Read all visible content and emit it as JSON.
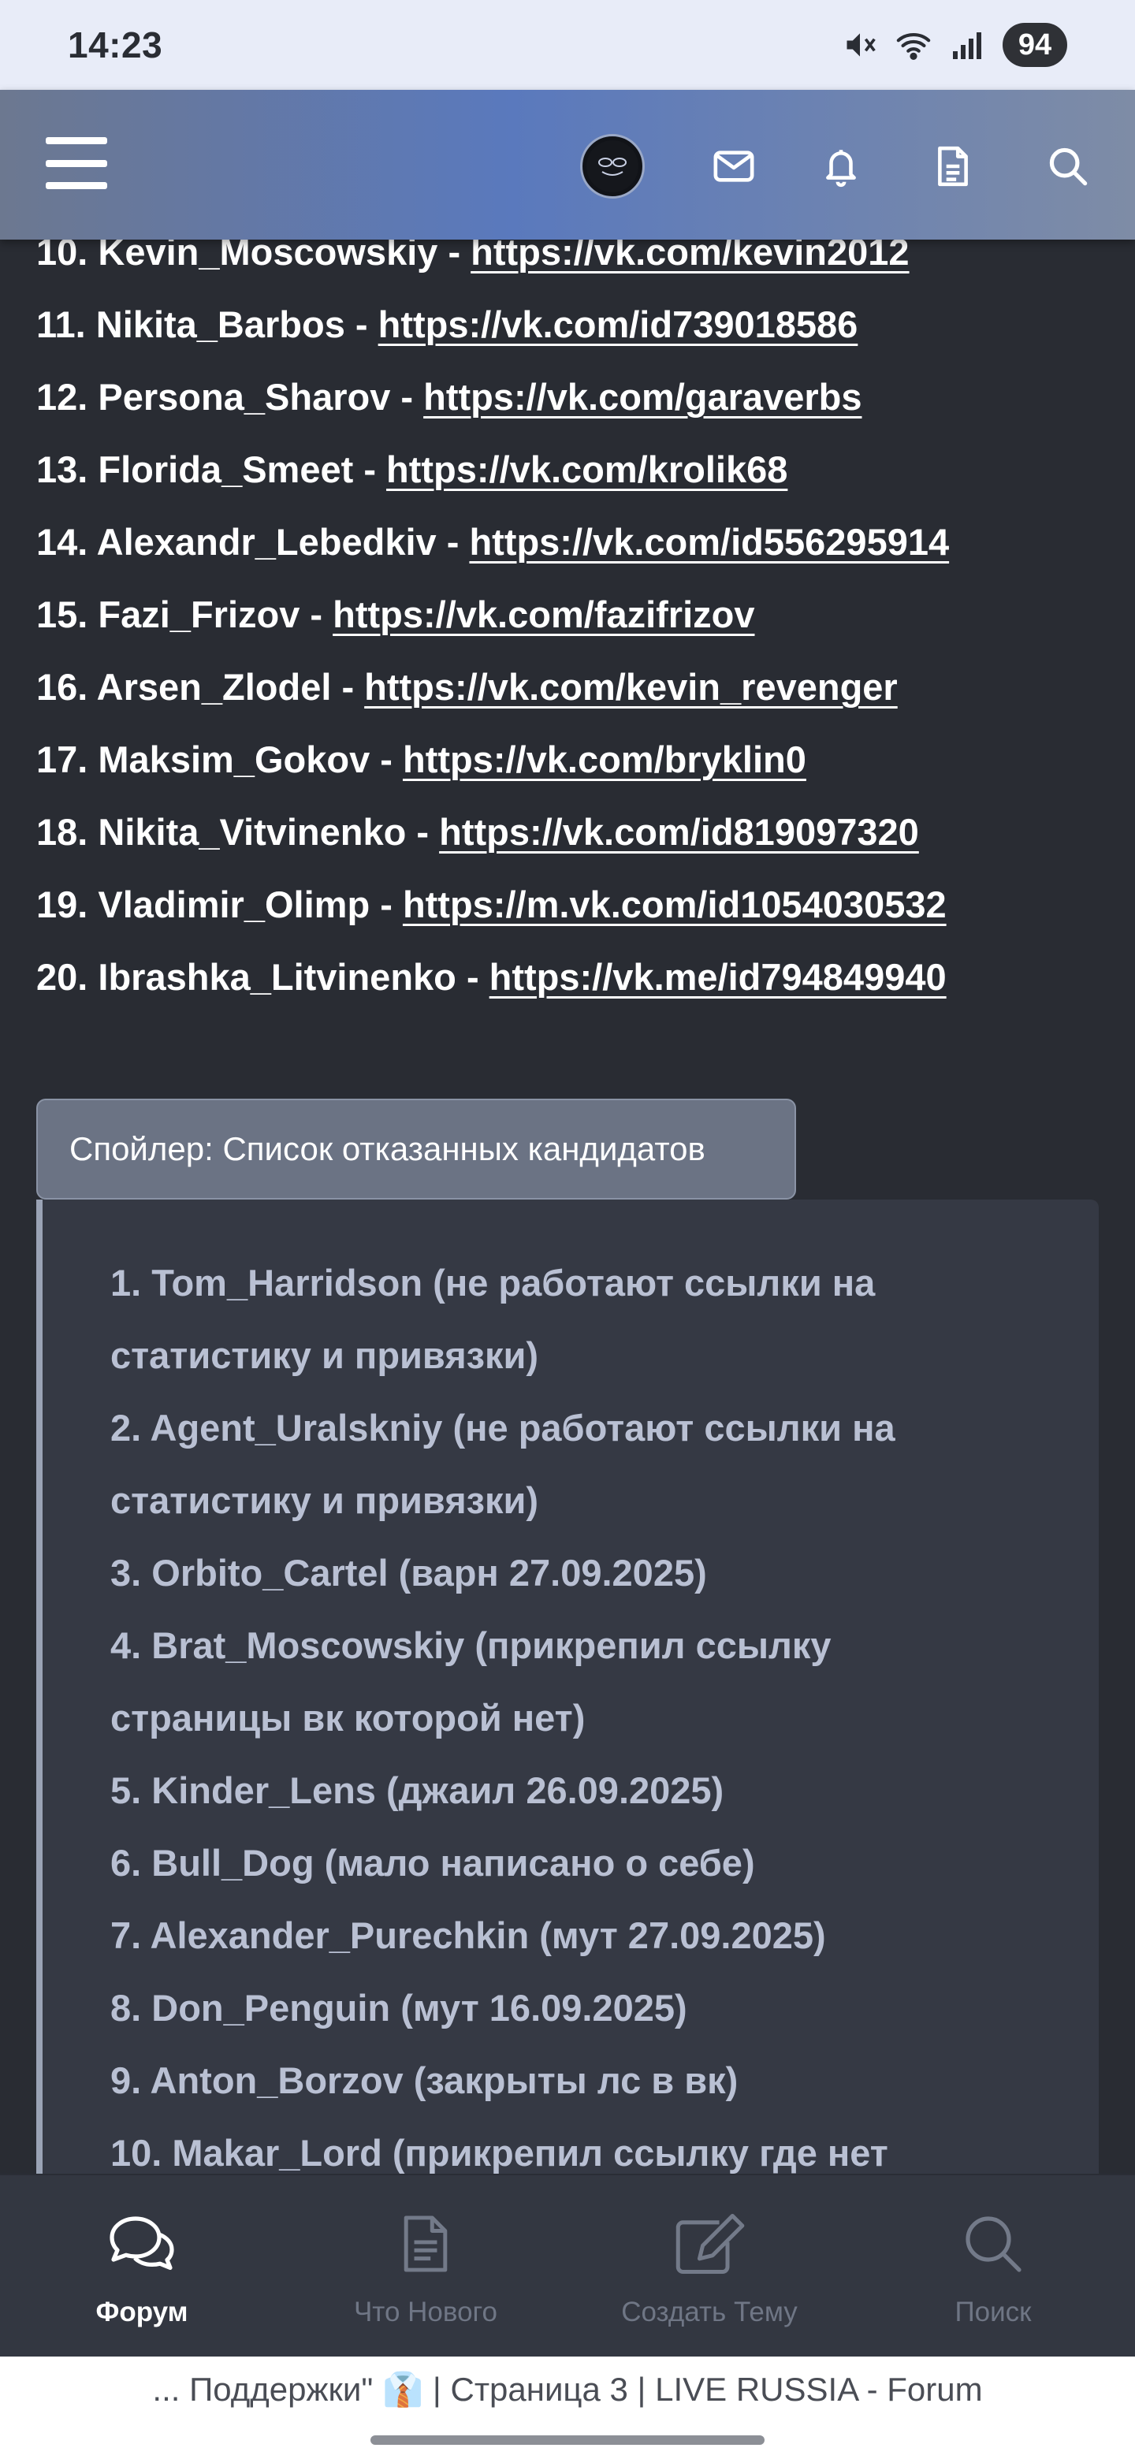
{
  "status_bar": {
    "time": "14:23",
    "battery": "94",
    "icons": [
      "mute-icon",
      "wifi-icon",
      "signal-icon"
    ]
  },
  "header": {
    "icons": [
      "menu-icon",
      "avatar",
      "mail-icon",
      "bell-icon",
      "document-icon",
      "search-icon"
    ]
  },
  "accepted_list": [
    {
      "text": "10. Kevin_Moscowskiy - ",
      "link": "https://vk.com/kevin2012"
    },
    {
      "text": "11. Nikita_Barbos - ",
      "link": "https://vk.com/id739018586"
    },
    {
      "text": "12. Persona_Sharov - ",
      "link": "https://vk.com/garaverbs"
    },
    {
      "text": "13. Florida_Smeet - ",
      "link": "https://vk.com/krolik68"
    },
    {
      "text": "14. Alexandr_Lebedkiv - ",
      "link": "https://vk.com/id556295914"
    },
    {
      "text": "15. Fazi_Frizov - ",
      "link": "https://vk.com/fazifrizov"
    },
    {
      "text": "16. Arsen_Zlodel - ",
      "link": "https://vk.com/kevin_revenger"
    },
    {
      "text": "17. Maksim_Gokov - ",
      "link": "https://vk.com/bryklin0"
    },
    {
      "text": "18. Nikita_Vitvinenko - ",
      "link": "https://vk.com/id819097320"
    },
    {
      "text": "19. Vladimir_Olimp - ",
      "link": "https://m.vk.com/id1054030532"
    },
    {
      "text": "20. Ibrashka_Litvinenko - ",
      "link": "https://vk.me/id794849940"
    }
  ],
  "spoiler": {
    "button_label": "Спойлер: Список отказанных кандидатов",
    "lines": [
      "1. Tom_Harridson (не работают ссылки на",
      "статистику и привязки)",
      "2. Agent_Uralskniy (не работают ссылки на",
      "статистику и привязки)",
      "3. Orbito_Cartel (варн 27.09.2025)",
      "4. Brat_Moscowskiy (прикрепил ссылку",
      "страницы вк которой нет)",
      "5. Kinder_Lens (джаил 26.09.2025)",
      "6. Bull_Dog (мало написано о себе)",
      "7. Alexander_Purechkin (мут 27.09.2025)",
      "8. Don_Penguin (мут 16.09.2025)",
      "9. Anton_Borzov (закрыты лс в вк)",
      "10. Makar_Lord (прикрепил ссылку где нет"
    ]
  },
  "bottom_nav": [
    {
      "label": "Форум",
      "icon": "forum-icon",
      "active": true
    },
    {
      "label": "Что Нового",
      "icon": "whats-new-icon",
      "active": false
    },
    {
      "label": "Создать Тему",
      "icon": "create-topic-icon",
      "active": false
    },
    {
      "label": "Поиск",
      "icon": "search-icon",
      "active": false
    }
  ],
  "browser": {
    "page_title": "... Поддержки\" 👔 | Страница 3 | LIVE RUSSIA - Forum"
  }
}
